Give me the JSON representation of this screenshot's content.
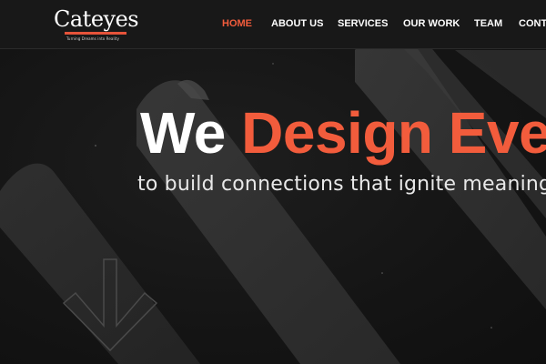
{
  "brand": {
    "logo_text": "Cateyes",
    "tagline": "Turning Dreams into Reality",
    "accent_color": "#f25c3c"
  },
  "nav": {
    "items": [
      {
        "label": "HOME",
        "active": true
      },
      {
        "label": "ABOUT US",
        "active": false
      },
      {
        "label": "SERVICES",
        "active": false
      },
      {
        "label": "OUR WORK",
        "active": false
      },
      {
        "label": "TEAM",
        "active": false
      },
      {
        "label": "CONTA",
        "active": false
      }
    ]
  },
  "hero": {
    "title_part1": "We",
    "title_part2": "Design Eve",
    "subtitle": "to build connections that ignite meaningfu"
  },
  "icons": {
    "scroll": "arrow-down-icon"
  }
}
